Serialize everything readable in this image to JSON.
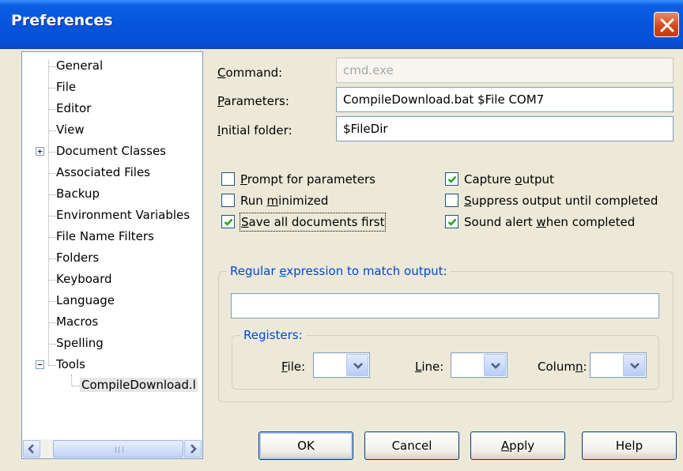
{
  "window": {
    "title": "Preferences"
  },
  "tree": {
    "items": [
      {
        "label": "General"
      },
      {
        "label": "File"
      },
      {
        "label": "Editor"
      },
      {
        "label": "View"
      },
      {
        "label": "Document Classes",
        "expander": "+"
      },
      {
        "label": "Associated Files"
      },
      {
        "label": "Backup"
      },
      {
        "label": "Environment Variables"
      },
      {
        "label": "File Name Filters"
      },
      {
        "label": "Folders"
      },
      {
        "label": "Keyboard"
      },
      {
        "label": "Language"
      },
      {
        "label": "Macros"
      },
      {
        "label": "Spelling"
      },
      {
        "label": "Tools",
        "expander": "−"
      }
    ],
    "child": {
      "label": "CompileDownload.l"
    },
    "scroll_grip": "III"
  },
  "form": {
    "command": {
      "label_u": "C",
      "label_rest": "ommand:",
      "value": "cmd.exe"
    },
    "parameters": {
      "label_u": "P",
      "label_rest": "arameters:",
      "value": "CompileDownload.bat $File COM7"
    },
    "initial_folder": {
      "label_u": "I",
      "label_rest": "nitial folder:",
      "value": "$FileDir"
    }
  },
  "options": {
    "prompt": {
      "u": "P",
      "rest": "rompt for parameters",
      "checked": false
    },
    "minimized": {
      "pre": "Run ",
      "u": "m",
      "rest": "inimized",
      "checked": false
    },
    "save_all": {
      "u": "S",
      "rest": "ave all documents first",
      "checked": true
    },
    "capture": {
      "pre": "Capture ",
      "u": "o",
      "rest": "utput",
      "checked": true
    },
    "suppress": {
      "u": "S",
      "rest": "uppress output until completed",
      "checked": false
    },
    "sound": {
      "pre": "Sound alert ",
      "u": "w",
      "rest": "hen completed",
      "checked": true
    }
  },
  "regex": {
    "caption_pre": "Regular ",
    "caption_u": "e",
    "caption_rest": "xpression to match output:",
    "value": ""
  },
  "registers": {
    "caption": "Registers:",
    "file": {
      "u": "F",
      "rest": "ile:",
      "value": ""
    },
    "line": {
      "u": "L",
      "rest": "ine:",
      "value": ""
    },
    "column": {
      "pre": "Colum",
      "u": "n",
      "rest": ":",
      "value": ""
    }
  },
  "buttons": {
    "ok": "OK",
    "cancel": "Cancel",
    "apply_u": "A",
    "apply_rest": "pply",
    "help": "Help"
  }
}
